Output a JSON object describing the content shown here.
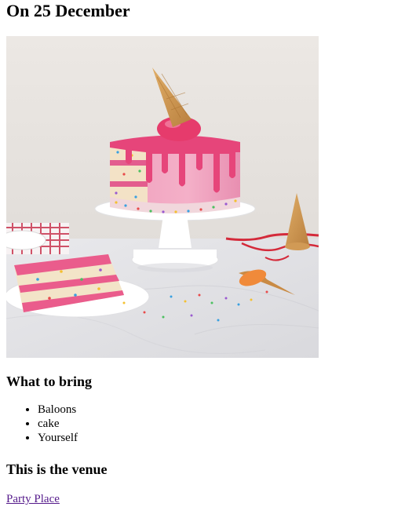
{
  "page": {
    "title": "On 25 December"
  },
  "hero_image": {
    "alt": "Pink drip funfetti cake with ice cream cone",
    "colors": {
      "wall": "#ece8e4",
      "marble": "#e6e6e8",
      "frosting": "#f2a3bf",
      "drip": "#e6457a",
      "cone": "#d19a55",
      "stand": "#ffffff",
      "sponge": "#f1e1c3"
    }
  },
  "bring_section": {
    "heading": "What to bring",
    "items": [
      "Baloons",
      "cake",
      "Yourself"
    ]
  },
  "venue_section": {
    "heading": "This is the venue",
    "link_text": "Party Place"
  }
}
